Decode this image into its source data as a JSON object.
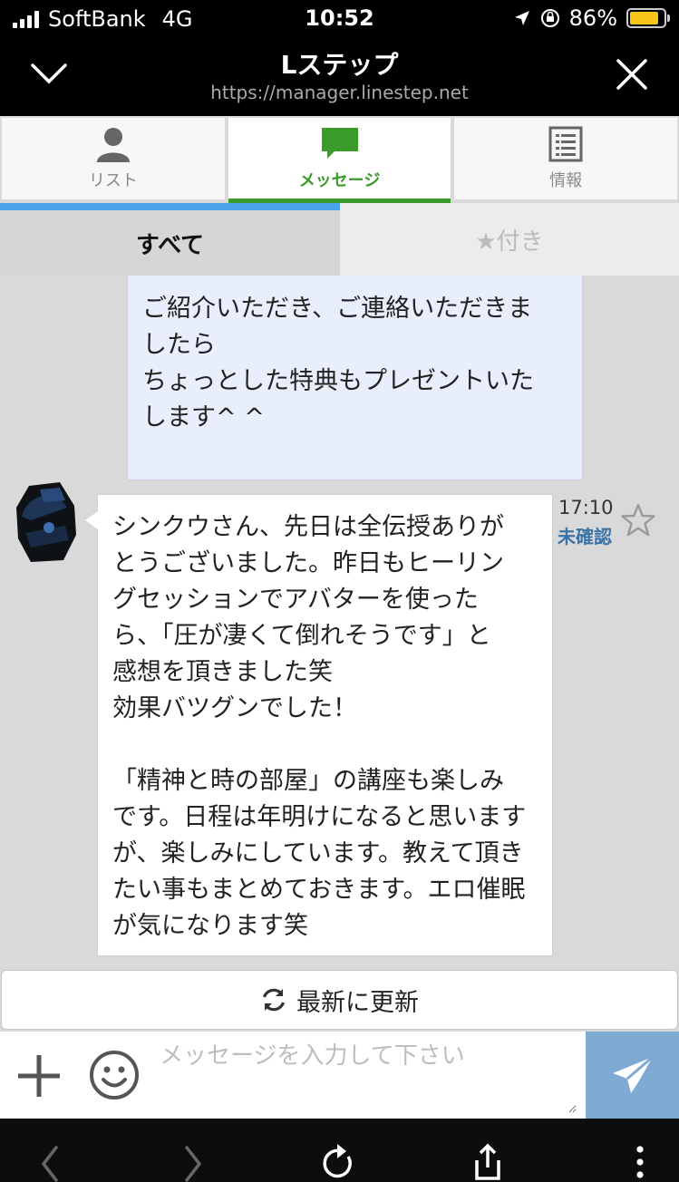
{
  "status_bar": {
    "carrier": "SoftBank",
    "network": "4G",
    "time": "10:52",
    "battery_percent": "86%",
    "battery_level": 0.86,
    "battery_color": "#f5c518"
  },
  "header": {
    "title": "Lステップ",
    "url": "https://manager.linestep.net",
    "left_icon": "chevron-down-icon",
    "right_icon": "close-icon"
  },
  "tabs": [
    {
      "label": "リスト",
      "icon": "person-icon",
      "active": false
    },
    {
      "label": "メッセージ",
      "icon": "chat-bubble-icon",
      "active": true
    },
    {
      "label": "情報",
      "icon": "document-list-icon",
      "active": false
    }
  ],
  "filters": {
    "all_label": "すべて",
    "starred_label": "★付き"
  },
  "messages": {
    "outgoing": {
      "text": "ご紹介いただき、ご連絡いただきま\nしたら\nちょっとした特典もプレゼントいた\nします^ ^"
    },
    "incoming": {
      "text": "シンクウさん、先日は全伝授ありが\nとうございました。昨日もヒーリン\nグセッションでアバターを使った\nら、「圧が凄くて倒れそうです」と\n感想を頂きました笑\n効果バツグンでした！\n\n「精神と時の部屋」の講座も楽しみ\nです。日程は年明けになると思います\nが、楽しみにしています。教えて頂き\nたい事もまとめておきます。エロ催眠\nが気になります笑",
      "time": "17:10",
      "status": "未確認"
    }
  },
  "refresh_label": "最新に更新",
  "input": {
    "placeholder": "メッセージを入力して下さい"
  },
  "colors": {
    "accent_green": "#3a9a2a",
    "active_filter_bar": "#4aa3e8",
    "send_button": "#7eaad3",
    "outgoing_bubble": "#e8eefc",
    "unread_status": "#3a73a8"
  }
}
